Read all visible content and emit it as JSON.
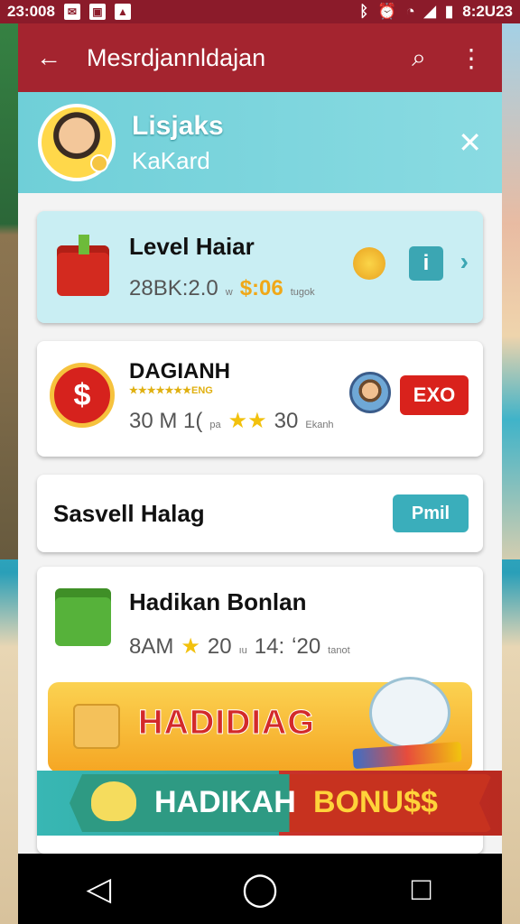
{
  "status_bar": {
    "time_left": "23:008",
    "time_right": "8:2U23",
    "icons": [
      "notification-icon",
      "notification-icon",
      "notification-icon"
    ],
    "right_icons": [
      "bluetooth-icon",
      "alarm-icon",
      "wifi-icon",
      "signal-icon",
      "battery-icon"
    ]
  },
  "app_bar": {
    "title": "Mesrdjannldajan",
    "back_icon": "back-arrow-icon",
    "search_icon": "search-icon",
    "menu_icon": "more-vert-icon"
  },
  "profile": {
    "name": "Lisjaks",
    "subtitle": "KaKard",
    "close_icon": "close-icon"
  },
  "cards": [
    {
      "title": "Level Haiar",
      "meta_a": "28BK:2.0",
      "meta_b": "w",
      "meta_price": "$:06",
      "meta_small": "tugok",
      "info_label": "i"
    },
    {
      "title": "DAGIANH",
      "subtitle": "★★★★★★★ENG",
      "meta_a": "30 M 1(",
      "meta_unit": "pa",
      "meta_stars": "★★",
      "meta_b": "30",
      "meta_small": "Ekanh",
      "coin_label": "$",
      "action_label": "EXO"
    },
    {
      "title": "Sasvell Halag",
      "action_label": "Pmil"
    },
    {
      "title": "Hadikan Bonlan",
      "meta_a": "8AM",
      "meta_star": "★",
      "meta_b": "20",
      "meta_unit": "ıu",
      "meta_c": "14:",
      "meta_d": "ʻ20",
      "meta_small": "tanot"
    }
  ],
  "promo1": {
    "label": "HADIDIAG"
  },
  "promo2": {
    "label_left": "HADIKAH",
    "label_right": "BONU$$"
  },
  "nav": {
    "back": "◁",
    "home": "◯",
    "recents": "□"
  },
  "colors": {
    "app_bar": "#a4242f",
    "accent": "#3aaebb",
    "danger": "#d9221c"
  }
}
